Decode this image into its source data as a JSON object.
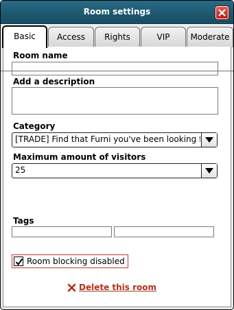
{
  "window": {
    "title": "Room settings"
  },
  "tabs": [
    {
      "label": "Basic",
      "active": true
    },
    {
      "label": "Access",
      "active": false
    },
    {
      "label": "Rights",
      "active": false
    },
    {
      "label": "VIP",
      "active": false
    },
    {
      "label": "Moderate",
      "active": false
    }
  ],
  "form": {
    "room_name_label": "Room name",
    "room_name_value": "",
    "description_label": "Add a description",
    "description_value": "",
    "category_label": "Category",
    "category_value": "[TRADE] Find that Furni you've been looking for",
    "max_visitors_label": "Maximum amount of visitors",
    "max_visitors_value": "25",
    "tags_label": "Tags",
    "tag1_value": "",
    "tag2_value": "",
    "room_blocking_label": "Room blocking disabled",
    "room_blocking_checked": true,
    "delete_label": "Delete this room"
  },
  "colors": {
    "titlebar": "#1f5a72",
    "close": "#c9302c",
    "delete": "#b0311c"
  }
}
